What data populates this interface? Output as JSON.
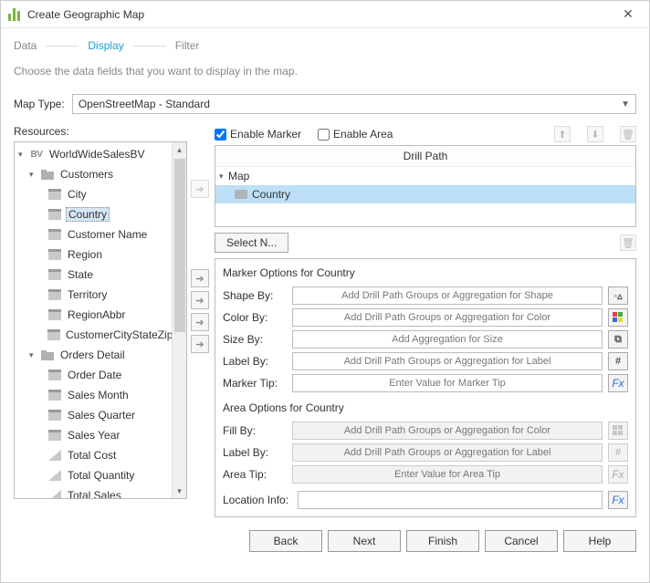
{
  "title": "Create Geographic Map",
  "steps": {
    "data": "Data",
    "display": "Display",
    "filter": "Filter",
    "active": "display"
  },
  "subtitle": "Choose the data fields that you want to display in the map.",
  "mapType": {
    "label": "Map Type:",
    "value": "OpenStreetMap - Standard"
  },
  "resourcesLabel": "Resources:",
  "tree": {
    "root": "WorldWideSalesBV",
    "group1": "Customers",
    "group1_items": [
      "City",
      "Country",
      "Customer Name",
      "Region",
      "State",
      "Territory",
      "RegionAbbr",
      "CustomerCityStateZip"
    ],
    "group2": "Orders Detail",
    "group2_items": [
      "Order Date",
      "Sales Month",
      "Sales Quarter",
      "Sales Year",
      "Total Cost",
      "Total Quantity",
      "Total Sales"
    ],
    "selected": "Country"
  },
  "right": {
    "enableMarker": "Enable Marker",
    "enableArea": "Enable Area",
    "enableMarkerChecked": true,
    "enableAreaChecked": false,
    "drillHeader": "Drill Path",
    "drillRoot": "Map",
    "drillChild": "Country",
    "selectN": "Select N...",
    "markerTitle": "Marker Options for Country",
    "areaTitle": "Area Options for Country",
    "labels": {
      "shapeBy": "Shape By:",
      "colorBy": "Color By:",
      "sizeBy": "Size By:",
      "labelBy": "Label By:",
      "markerTip": "Marker Tip:",
      "fillBy": "Fill By:",
      "labelBy2": "Label By:",
      "areaTip": "Area Tip:",
      "locInfo": "Location Info:"
    },
    "placeholders": {
      "shape": "Add Drill Path Groups or Aggregation for Shape",
      "color": "Add Drill Path Groups or Aggregation for Color",
      "size": "Add Aggregation for Size",
      "label": "Add Drill Path Groups or Aggregation for Label",
      "markerTip": "Enter Value for Marker Tip",
      "fill": "Add Drill Path Groups or Aggregation for Color",
      "label2": "Add Drill Path Groups or Aggregation for Label",
      "areaTip": "Enter Value for Area Tip",
      "loc": ""
    }
  },
  "footer": {
    "back": "Back",
    "next": "Next",
    "finish": "Finish",
    "cancel": "Cancel",
    "help": "Help"
  }
}
